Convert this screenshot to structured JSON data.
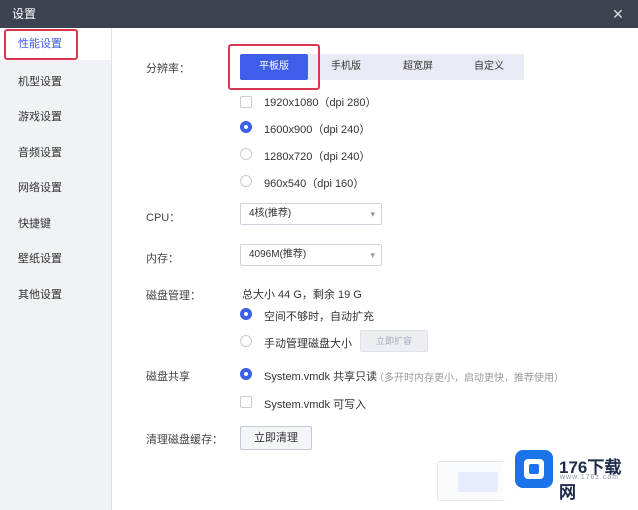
{
  "window": {
    "title": "设置",
    "close_glyph": "✕"
  },
  "sidebar": {
    "items": [
      {
        "label": "性能设置",
        "active": true
      },
      {
        "label": "机型设置"
      },
      {
        "label": "游戏设置"
      },
      {
        "label": "音频设置"
      },
      {
        "label": "网络设置"
      },
      {
        "label": "快捷键"
      },
      {
        "label": "壁纸设置"
      },
      {
        "label": "其他设置"
      }
    ]
  },
  "resolution": {
    "label": "分辨率：",
    "tabs": [
      "平板版",
      "手机版",
      "超宽屏",
      "自定义"
    ],
    "selected_tab": "平板版",
    "options": [
      "1920x1080（dpi 280）",
      "1600x900（dpi 240）",
      "1280x720（dpi 240）",
      "960x540（dpi 160）"
    ],
    "selected_option": "1600x900（dpi 240）"
  },
  "cpu": {
    "label": "CPU：",
    "value": "4核(推荐)"
  },
  "memory": {
    "label": "内存：",
    "value": "4096M(推荐)"
  },
  "disk": {
    "label": "磁盘管理：",
    "summary": "总大小 44 G，剩余 19 G",
    "options": [
      "空间不够时，自动扩充",
      "手动管理磁盘大小"
    ],
    "selected_option": "空间不够时，自动扩充",
    "manual_button": "立即扩容"
  },
  "disk_share": {
    "label": "磁盘共享",
    "options": [
      "System.vmdk 共享只读",
      "System.vmdk 可写入"
    ],
    "selected_option": "System.vmdk 共享只读",
    "note": "（多开时内存更小，启动更快，推荐使用）"
  },
  "clear_cache": {
    "label": "清理磁盘缓存：",
    "button": "立即清理"
  },
  "watermark": {
    "brand": "176下载网",
    "url": "www.176z.com"
  },
  "colors": {
    "accent": "#3c5ee8",
    "highlight": "#d9374d",
    "titlebar": "#3d4150"
  }
}
